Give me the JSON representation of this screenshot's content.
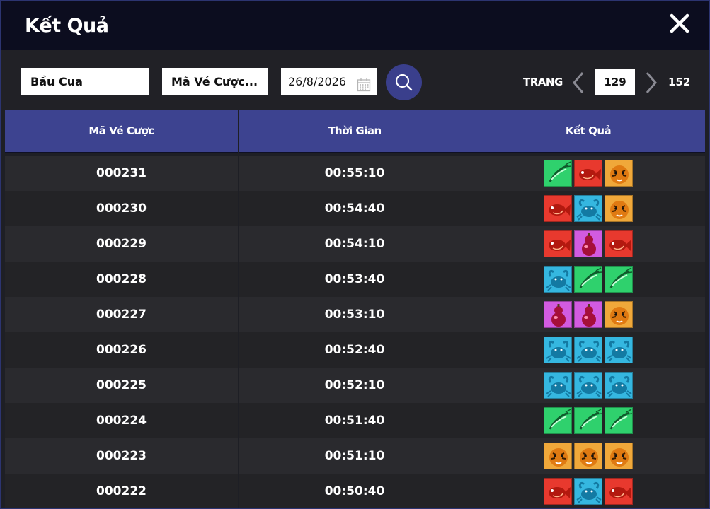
{
  "window": {
    "title": "Kết Quả"
  },
  "filters": {
    "game": "Bầu Cua",
    "ticket_code": "Mã Vé Cược...",
    "date": "26/8/2026"
  },
  "pagination": {
    "label": "TRANG",
    "current": "129",
    "total": "152"
  },
  "table": {
    "headers": [
      "Mã Vé Cược",
      "Thời Gian",
      "Kết Quả"
    ],
    "rows": [
      {
        "code": "000231",
        "time": "00:55:10",
        "result": [
          "shrimp",
          "fish",
          "tiger"
        ]
      },
      {
        "code": "000230",
        "time": "00:54:40",
        "result": [
          "fish",
          "crab",
          "tiger"
        ]
      },
      {
        "code": "000229",
        "time": "00:54:10",
        "result": [
          "fish",
          "gourd",
          "fish"
        ]
      },
      {
        "code": "000228",
        "time": "00:53:40",
        "result": [
          "crab",
          "shrimp",
          "shrimp"
        ]
      },
      {
        "code": "000227",
        "time": "00:53:10",
        "result": [
          "gourd",
          "gourd",
          "tiger"
        ]
      },
      {
        "code": "000226",
        "time": "00:52:40",
        "result": [
          "crab",
          "crab",
          "crab"
        ]
      },
      {
        "code": "000225",
        "time": "00:52:10",
        "result": [
          "crab",
          "crab",
          "crab"
        ]
      },
      {
        "code": "000224",
        "time": "00:51:40",
        "result": [
          "shrimp",
          "shrimp",
          "shrimp"
        ]
      },
      {
        "code": "000223",
        "time": "00:51:10",
        "result": [
          "tiger",
          "tiger",
          "tiger"
        ]
      },
      {
        "code": "000222",
        "time": "00:50:40",
        "result": [
          "fish",
          "crab",
          "fish"
        ]
      }
    ]
  },
  "icon_colors": {
    "shrimp": "#2fd16d",
    "fish": "#e8392e",
    "tiger": "#f0a83a",
    "crab": "#35b7e0",
    "gourd": "#d25be0"
  }
}
